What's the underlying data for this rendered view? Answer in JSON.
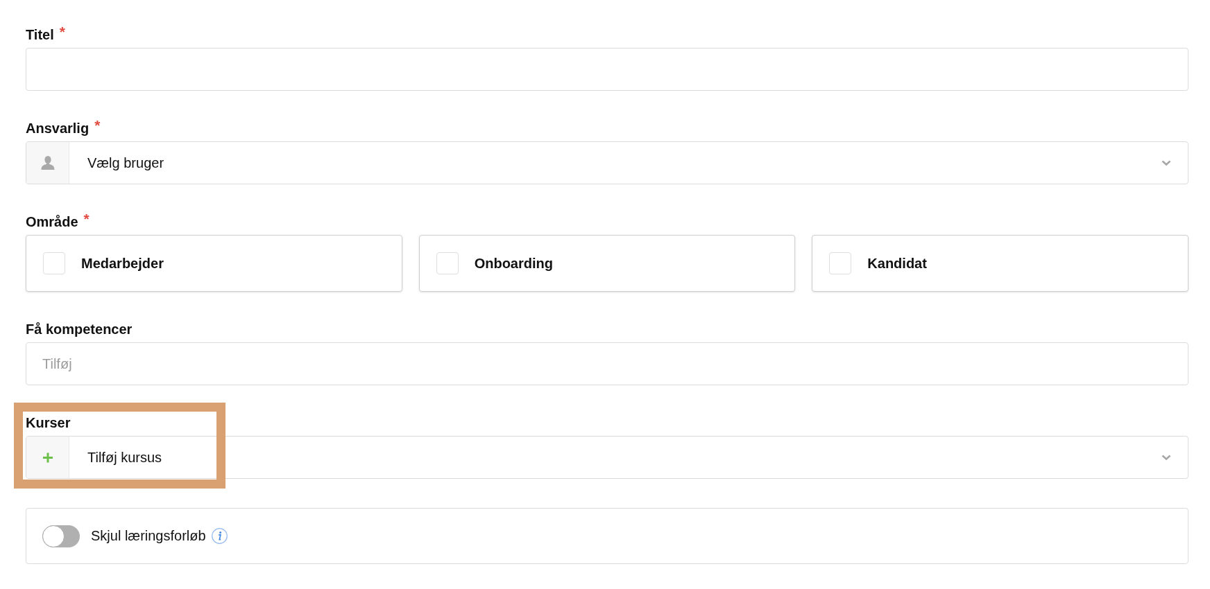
{
  "fields": [
    {
      "kind": "text",
      "label": "Titel",
      "required_mark": "*"
    },
    {
      "kind": "user_select",
      "label": "Ansvarlig",
      "required_mark": "*",
      "value": "Vælg bruger"
    },
    {
      "kind": "checkboxes",
      "label": "Område",
      "required_mark": "*",
      "options": [
        {
          "label": "Medarbejder",
          "checked": false
        },
        {
          "label": "Onboarding",
          "checked": false
        },
        {
          "label": "Kandidat",
          "checked": false
        }
      ]
    },
    {
      "kind": "text",
      "label": "Få kompetencer",
      "placeholder": "Tilføj"
    },
    {
      "kind": "add_select",
      "label": "Kurser",
      "value": "Tilføj kursus",
      "highlighted": true
    },
    {
      "kind": "toggle",
      "label": "Skjul læringsforløb",
      "on": false,
      "info": true
    }
  ]
}
